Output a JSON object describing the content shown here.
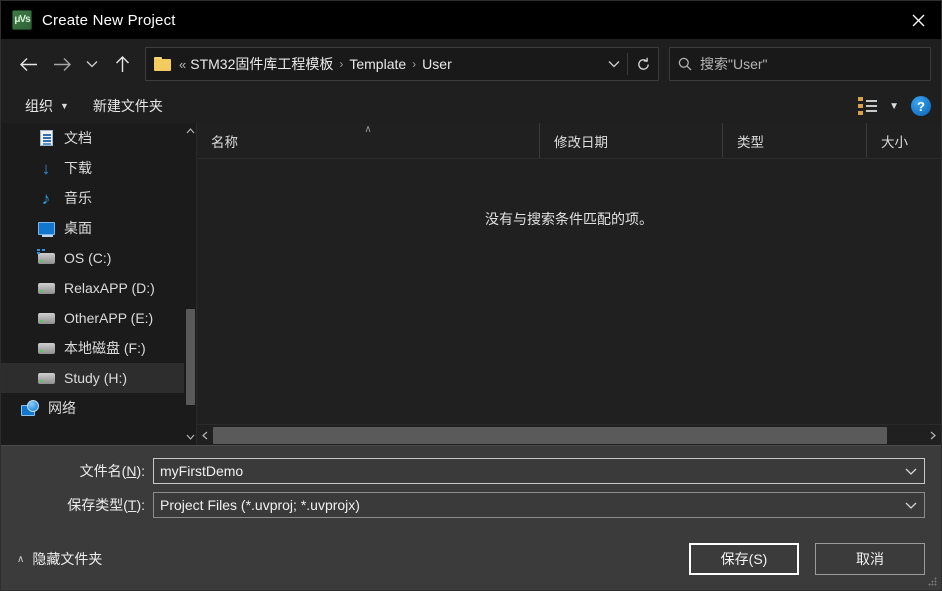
{
  "window": {
    "title": "Create New Project",
    "app_icon": "uvision-icon",
    "close_label": "✕"
  },
  "nav": {
    "back_icon": "arrow-left-icon",
    "forward_icon": "arrow-right-icon",
    "recent_icon": "chevron-down-icon",
    "up_icon": "arrow-up-icon",
    "folder_icon": "folder-icon",
    "overflow": "«",
    "separator": "›",
    "crumbs": [
      "STM32固件库工程模板",
      "Template",
      "User"
    ],
    "dropdown_icon": "chevron-down-icon",
    "refresh_icon": "refresh-icon"
  },
  "search": {
    "icon": "search-icon",
    "placeholder": "搜索\"User\""
  },
  "toolbar": {
    "organize_label": "组织",
    "organize_caret": "▼",
    "new_folder_label": "新建文件夹",
    "view_icon": "view-layout-icon",
    "view_caret": "▼",
    "help_label": "?"
  },
  "sidebar": {
    "scroll_up_icon": "chevron-up-icon",
    "scroll_down_icon": "chevron-down-icon",
    "items": [
      {
        "label": "文档",
        "icon": "documents-icon",
        "type": "doc",
        "selected": false
      },
      {
        "label": "下载",
        "icon": "downloads-icon",
        "type": "dl",
        "selected": false
      },
      {
        "label": "音乐",
        "icon": "music-icon",
        "type": "music",
        "selected": false
      },
      {
        "label": "桌面",
        "icon": "desktop-icon",
        "type": "desktop",
        "selected": false
      },
      {
        "label": "OS (C:)",
        "icon": "os-drive-icon",
        "type": "os",
        "selected": false
      },
      {
        "label": "RelaxAPP (D:)",
        "icon": "drive-icon",
        "type": "drive",
        "selected": false
      },
      {
        "label": "OtherAPP (E:)",
        "icon": "drive-icon",
        "type": "drive",
        "selected": false
      },
      {
        "label": "本地磁盘 (F:)",
        "icon": "drive-icon",
        "type": "drive",
        "selected": false
      },
      {
        "label": "Study (H:)",
        "icon": "drive-icon",
        "type": "drive",
        "selected": true
      },
      {
        "label": "网络",
        "icon": "network-icon",
        "type": "network",
        "selected": false
      }
    ]
  },
  "filelist": {
    "columns": [
      {
        "label": "名称",
        "sorted": true,
        "sort_caret": "∧"
      },
      {
        "label": "修改日期",
        "sorted": false,
        "sort_caret": ""
      },
      {
        "label": "类型",
        "sorted": false,
        "sort_caret": ""
      },
      {
        "label": "大小",
        "sorted": false,
        "sort_caret": ""
      }
    ],
    "rows": [],
    "empty_message": "没有与搜索条件匹配的项。",
    "hscroll_left_icon": "chevron-left-icon",
    "hscroll_right_icon": "chevron-right-icon"
  },
  "form": {
    "filename_label_pre": "文件名(",
    "filename_label_key": "N",
    "filename_label_post": "):",
    "filename_value": "myFirstDemo",
    "filetype_label_pre": "保存类型(",
    "filetype_label_key": "T",
    "filetype_label_post": "):",
    "filetype_value": "Project Files (*.uvproj; *.uvprojx)",
    "caret_icon": "chevron-down-icon"
  },
  "footer": {
    "hide_folders_caret": "∧",
    "hide_folders_label": "隐藏文件夹",
    "save_label": "保存(S)",
    "cancel_label": "取消",
    "resize_grip": "resize-grip-icon"
  },
  "colors": {
    "titlebar_bg": "#000000",
    "window_bg": "#1f1f1f",
    "list_bg": "#202020",
    "footer_bg": "#3b3b3b",
    "selection_bg": "#2d2d2d",
    "accent_blue": "#1573c4",
    "folder_yellow": "#f3cb5f"
  }
}
